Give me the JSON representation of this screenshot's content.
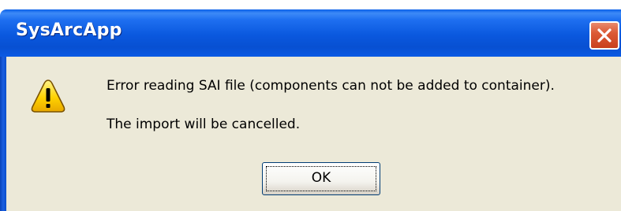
{
  "dialog": {
    "title": "SysArcApp",
    "close_icon": "close-icon",
    "warning_icon": "warning-icon",
    "message_line1": "Error reading SAI file (components can not be added to container).",
    "message_line2": "The import will be cancelled.",
    "ok_label": "OK"
  },
  "colors": {
    "titlebar": "#0a58de",
    "client_background": "#ece9d8",
    "close_button": "#dc5a36",
    "warning_yellow": "#ffd200"
  }
}
